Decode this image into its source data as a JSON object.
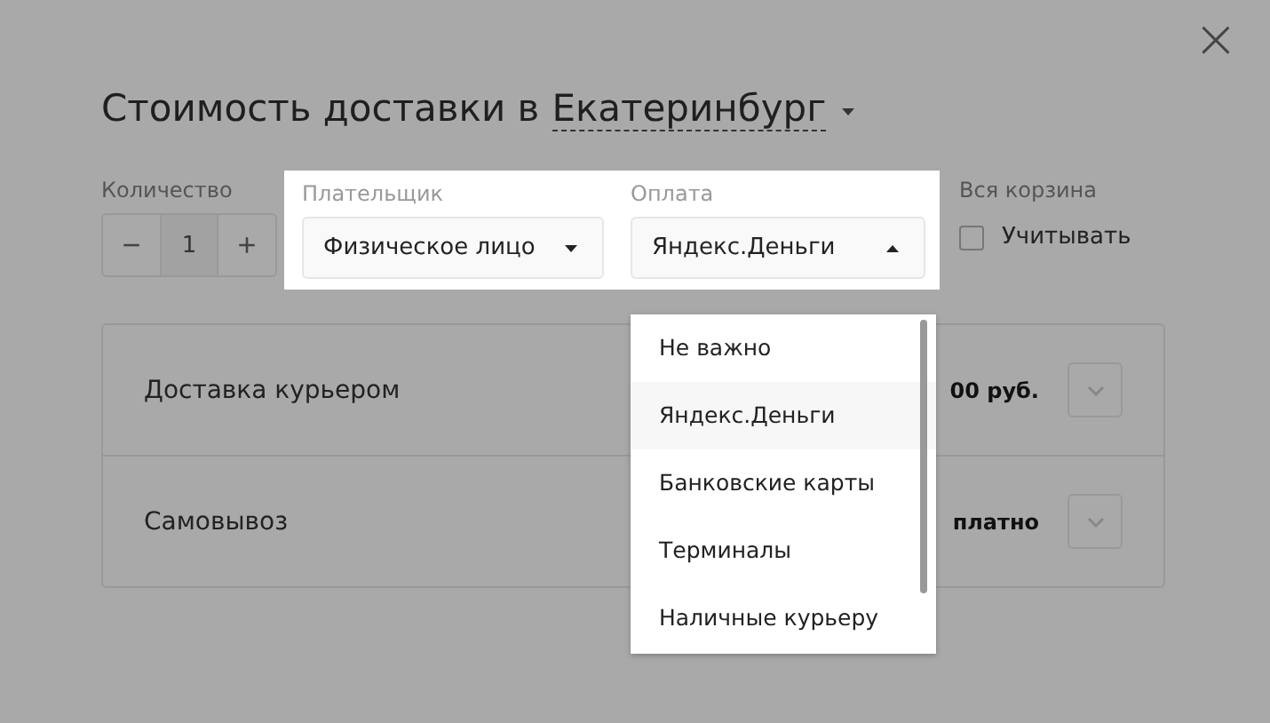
{
  "title": {
    "text": "Стоимость доставки в",
    "city": "Екатеринбург"
  },
  "close": "×",
  "quantity": {
    "label": "Количество",
    "minus": "−",
    "value": "1",
    "plus": "+"
  },
  "payer": {
    "label": "Плательщик",
    "value": "Физическое лицо",
    "expanded": false
  },
  "payment": {
    "label": "Оплата",
    "value": "Яндекс.Деньги",
    "expanded": true,
    "options": [
      {
        "label": "Не важно",
        "selected": false
      },
      {
        "label": "Яндекс.Деньги",
        "selected": true
      },
      {
        "label": "Банковские карты",
        "selected": false
      },
      {
        "label": "Терминалы",
        "selected": false
      },
      {
        "label": "Наличные курьеру",
        "selected": false
      }
    ]
  },
  "cart": {
    "label": "Вся корзина",
    "checkbox": "Учитывать",
    "checked": false
  },
  "delivery": [
    {
      "name": "Доставка курьером",
      "price": "00 руб."
    },
    {
      "name": "Самовывоз",
      "price": "платно"
    }
  ]
}
